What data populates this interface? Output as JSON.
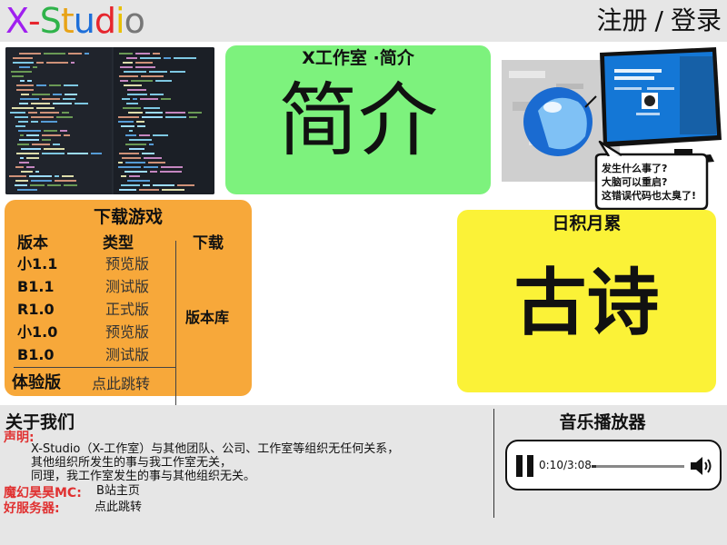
{
  "header": {
    "logo": {
      "letters": [
        {
          "char": "X",
          "color": "#a020f0"
        },
        {
          "char": "-",
          "color": "#e6262e"
        },
        {
          "char": "S",
          "color": "#2fb34a"
        },
        {
          "char": "t",
          "color": "#e8a317"
        },
        {
          "char": "u",
          "color": "#1e6fd9"
        },
        {
          "char": "d",
          "color": "#e6262e"
        },
        {
          "char": "i",
          "color": "#e8c000"
        },
        {
          "char": "o",
          "color": "#777777"
        }
      ]
    },
    "register_label": "注册",
    "separator": "/",
    "login_label": "登录"
  },
  "intro_card": {
    "title": "X工作室 ·简介",
    "big_text": "简介",
    "color": "#7df27d"
  },
  "meme": {
    "monitor_text_1": "你的电脑遇到了问题，需要重启",
    "monitor_text_2": "114514",
    "bubble_lines": [
      "发生什么事了?",
      "大脑可以重启?",
      "这错误代码也太臭了!"
    ]
  },
  "download": {
    "title": "下载游戏",
    "header_version": "版本",
    "header_type": "类型",
    "header_download": "下载",
    "rows": [
      {
        "version": "小1.1",
        "type": "预览版"
      },
      {
        "version": "B1.1",
        "type": "测试版"
      },
      {
        "version": "R1.0",
        "type": "正式版"
      },
      {
        "version": "小1.0",
        "type": "预览版"
      },
      {
        "version": "B1.0",
        "type": "测试版"
      }
    ],
    "library_label": "版本库",
    "experience_label": "体验版",
    "experience_link": "点此跳转",
    "color": "#f7a83a"
  },
  "poem_card": {
    "title": "日积月累",
    "big_text": "古诗",
    "color": "#fbf237"
  },
  "about": {
    "title": "关于我们",
    "statement_label": "声明:",
    "statement_lines": [
      "X-Studio（X-工作室）与其他团队、公司、工作室等组织无任何关系，",
      "其他组织所发生的事与我工作室无关，",
      "同理，我工作室发生的事与其他组织无关。"
    ],
    "mc_label": "魔幻昊昊MC:",
    "mc_value": "B站主页",
    "server_label": "好服务器:",
    "server_value": "点此跳转"
  },
  "music": {
    "title": "音乐播放器",
    "time": "0:10/3:08",
    "progress": 0.053
  }
}
